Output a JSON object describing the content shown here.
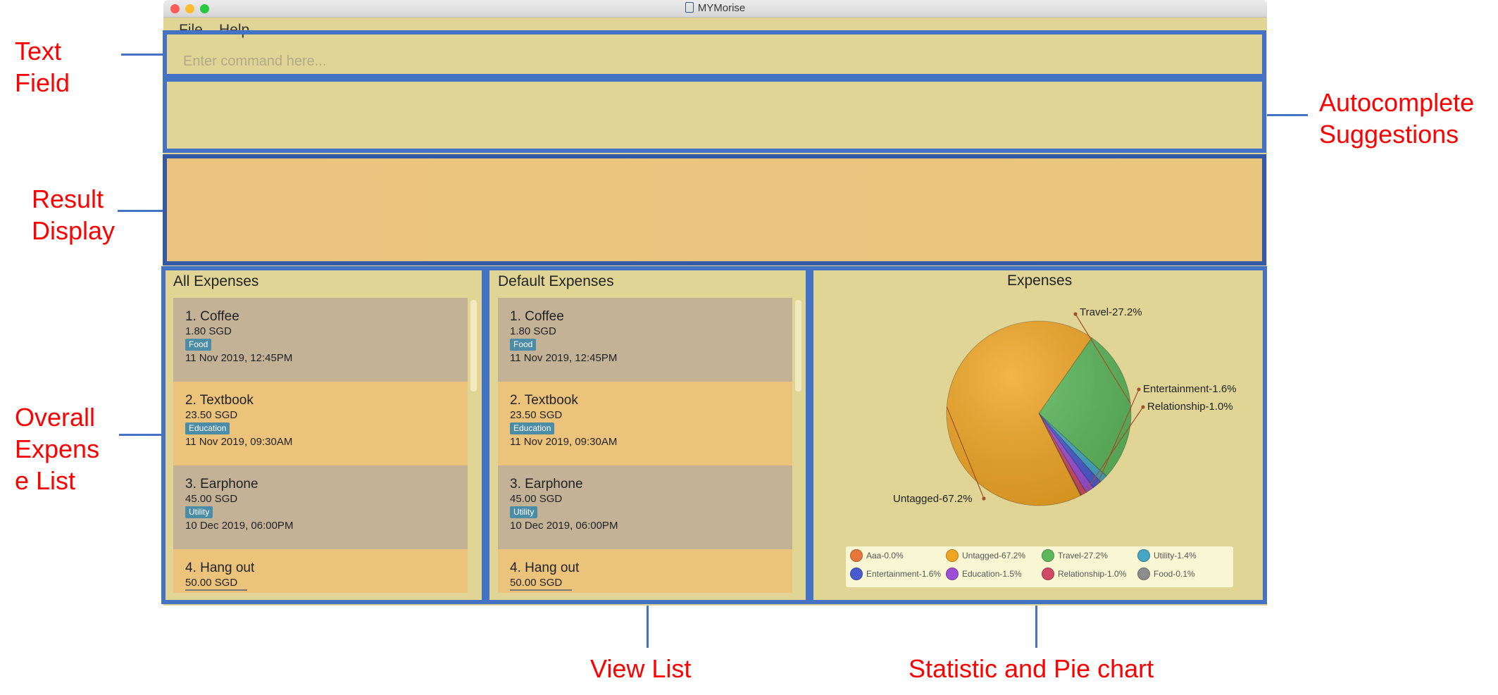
{
  "window": {
    "title": "MYMorise"
  },
  "menu": {
    "file": "File",
    "help": "Help"
  },
  "command_box": {
    "placeholder": "Enter command here..."
  },
  "annotations": {
    "text_field": "Text\nField",
    "autocomplete": "Autocomplete\nSuggestions",
    "result_display": "Result\nDisplay",
    "overall_list": "Overall\nExpens\ne List",
    "view_list": "View List",
    "statistic": "Statistic and Pie chart"
  },
  "all_expenses": {
    "title": "All Expenses",
    "items": [
      {
        "name": "1.  Coffee",
        "amount": "1.80 SGD",
        "tag": "Food",
        "date": "11 Nov 2019, 12:45PM"
      },
      {
        "name": "2.  Textbook",
        "amount": "23.50 SGD",
        "tag": "Education",
        "date": "11 Nov 2019, 09:30AM"
      },
      {
        "name": "3.  Earphone",
        "amount": "45.00 SGD",
        "tag": "Utility",
        "date": "10 Dec 2019, 06:00PM"
      },
      {
        "name": "4.  Hang out",
        "amount": "50.00 SGD"
      }
    ]
  },
  "default_expenses": {
    "title": "Default Expenses",
    "items": [
      {
        "name": "1.  Coffee",
        "amount": "1.80 SGD",
        "tag": "Food",
        "date": "11 Nov 2019, 12:45PM"
      },
      {
        "name": "2.  Textbook",
        "amount": "23.50 SGD",
        "tag": "Education",
        "date": "11 Nov 2019, 09:30AM"
      },
      {
        "name": "3.  Earphone",
        "amount": "45.00 SGD",
        "tag": "Utility",
        "date": "10 Dec 2019, 06:00PM"
      },
      {
        "name": "4.  Hang out",
        "amount": "50.00 SGD"
      }
    ]
  },
  "chart_data": {
    "type": "pie",
    "title": "Expenses",
    "slices": [
      {
        "label": "Aaa-0.0%",
        "value": 0.0,
        "color": "#e8763a"
      },
      {
        "label": "Untagged-67.2%",
        "value": 67.2,
        "color": "#f0a523"
      },
      {
        "label": "Travel-27.2%",
        "value": 27.2,
        "color": "#5cb85c"
      },
      {
        "label": "Utility-1.4%",
        "value": 1.4,
        "color": "#45a7c4"
      },
      {
        "label": "Entertainment-1.6%",
        "value": 1.6,
        "color": "#4a5bd1"
      },
      {
        "label": "Education-1.5%",
        "value": 1.5,
        "color": "#9c4fd6"
      },
      {
        "label": "Relationship-1.0%",
        "value": 1.0,
        "color": "#cf4a62"
      },
      {
        "label": "Food-0.1%",
        "value": 0.1,
        "color": "#8c8c8c"
      }
    ],
    "callouts": [
      "Travel-27.2%",
      "Entertainment-1.6%",
      "Relationship-1.0%",
      "Untagged-67.2%"
    ],
    "legend_position": "bottom"
  },
  "colors": {
    "accent": "#4472c4",
    "annotation": "#ff0000"
  }
}
